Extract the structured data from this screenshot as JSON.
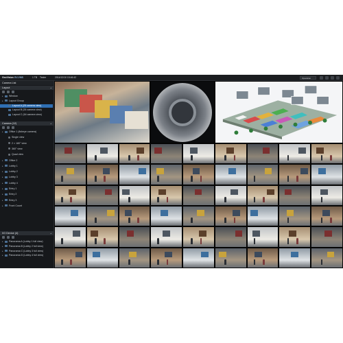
{
  "window": {
    "brand": "GeoVision",
    "version": "GV-VMS",
    "topbar_texts": [
      "1 TB",
      "Tester",
      "2014/12/10  15:46:42"
    ],
    "dropdown_value": "Operation"
  },
  "sidebar": {
    "camera_list_title": "Camera List",
    "layout_section": {
      "title": "Layout",
      "items": [
        {
          "label": "Window",
          "level": 1
        },
        {
          "label": "Layout Group",
          "level": 1
        },
        {
          "label": "Layout A (25 camera view)",
          "level": 2,
          "selected": true
        },
        {
          "label": "Layout B (26 camera view)",
          "level": 2
        },
        {
          "label": "Layout C (64 camera view)",
          "level": 2
        }
      ]
    },
    "camera_section": {
      "title": "Camera (12)",
      "items": [
        {
          "label": "Office 1 (fisheye camera)",
          "level": 1
        },
        {
          "label": "Single view",
          "level": 2
        },
        {
          "label": "2 × 180° view",
          "level": 2
        },
        {
          "label": "360° view",
          "level": 2
        },
        {
          "label": "Quad view",
          "level": 2
        },
        {
          "label": "Office 2",
          "level": 1
        },
        {
          "label": "Lobby 1",
          "level": 1
        },
        {
          "label": "Lobby 2",
          "level": 1
        },
        {
          "label": "Lobby 3",
          "level": 1
        },
        {
          "label": "Lobby 4",
          "level": 1
        },
        {
          "label": "Entry 1",
          "level": 1
        },
        {
          "label": "Entry 2",
          "level": 1
        },
        {
          "label": "Entry 3",
          "level": 1
        },
        {
          "label": "Front Count",
          "level": 1
        }
      ]
    },
    "io_section": {
      "title": "I/O Device (4)",
      "items": [
        {
          "label": "Panorama A (Lobby 1 full view)",
          "level": 1
        },
        {
          "label": "Panorama B (Lobby 2 full view)",
          "level": 1
        },
        {
          "label": "Panorama C (Lobby 3 full view)",
          "level": 1
        },
        {
          "label": "Panorama D (Lobby 4 full view)",
          "level": 1
        }
      ]
    }
  },
  "colors": {
    "background": "#111315",
    "selection": "#2f6fb3",
    "section_header": "#2a2e33"
  }
}
